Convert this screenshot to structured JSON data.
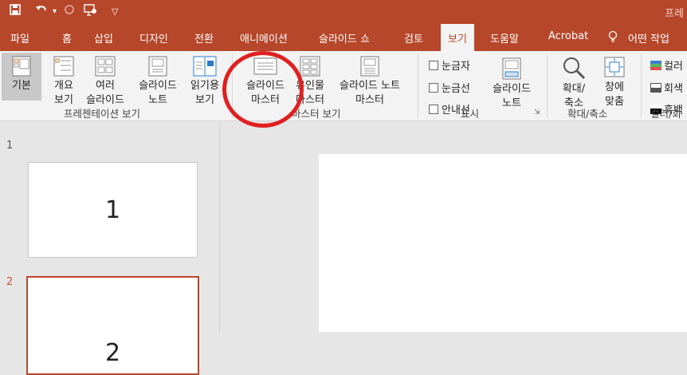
{
  "title_bar": {
    "title_fragment": "프레",
    "qat_icons": [
      "save-icon",
      "undo-icon",
      "redo-icon",
      "present-from-beginning-icon",
      "customize-qat-icon"
    ]
  },
  "tabs": [
    {
      "label": "파일",
      "active": false
    },
    {
      "label": "홈",
      "active": false
    },
    {
      "label": "삽입",
      "active": false
    },
    {
      "label": "디자인",
      "active": false
    },
    {
      "label": "전환",
      "active": false
    },
    {
      "label": "애니메이션",
      "active": false
    },
    {
      "label": "슬라이드 쇼",
      "active": false
    },
    {
      "label": "검토",
      "active": false
    },
    {
      "label": "보기",
      "active": true
    },
    {
      "label": "도움말",
      "active": false
    },
    {
      "label": "Acrobat",
      "active": false
    },
    {
      "label": "어떤 작업",
      "active": false
    }
  ],
  "ribbon": {
    "presentation_views": {
      "label": "프레젠테이션 보기",
      "buttons": [
        {
          "line1": "기본",
          "line2": "",
          "selected": true
        },
        {
          "line1": "개요",
          "line2": "보기",
          "selected": false
        },
        {
          "line1": "여러",
          "line2": "슬라이드",
          "selected": false
        },
        {
          "line1": "슬라이드",
          "line2": "노트",
          "selected": false
        },
        {
          "line1": "읽기용",
          "line2": "보기",
          "selected": false
        }
      ]
    },
    "master_views": {
      "label": "마스터 보기",
      "buttons": [
        {
          "line1": "슬라이드",
          "line2": "마스터"
        },
        {
          "line1": "유인물",
          "line2": "마스터"
        },
        {
          "line1": "슬라이드 노트",
          "line2": "마스터"
        }
      ]
    },
    "show": {
      "label": "표시",
      "checkboxes": [
        "눈금자",
        "눈금선",
        "안내선"
      ],
      "notes_button": {
        "line1": "슬라이드",
        "line2": "노트"
      }
    },
    "zoom": {
      "label": "확대/축소",
      "buttons": [
        {
          "line1": "확대/",
          "line2": "축소"
        },
        {
          "line1": "창에",
          "line2": "맞춤"
        }
      ]
    },
    "color": {
      "label": "컬러/회",
      "items": [
        "컬러",
        "회색",
        "흑백"
      ]
    }
  },
  "slides": [
    {
      "number": "1",
      "content": "1",
      "selected": false
    },
    {
      "number": "2",
      "content": "2",
      "selected": true
    }
  ],
  "colors": {
    "accent": "#b7472a",
    "annotation": "#e02020"
  }
}
